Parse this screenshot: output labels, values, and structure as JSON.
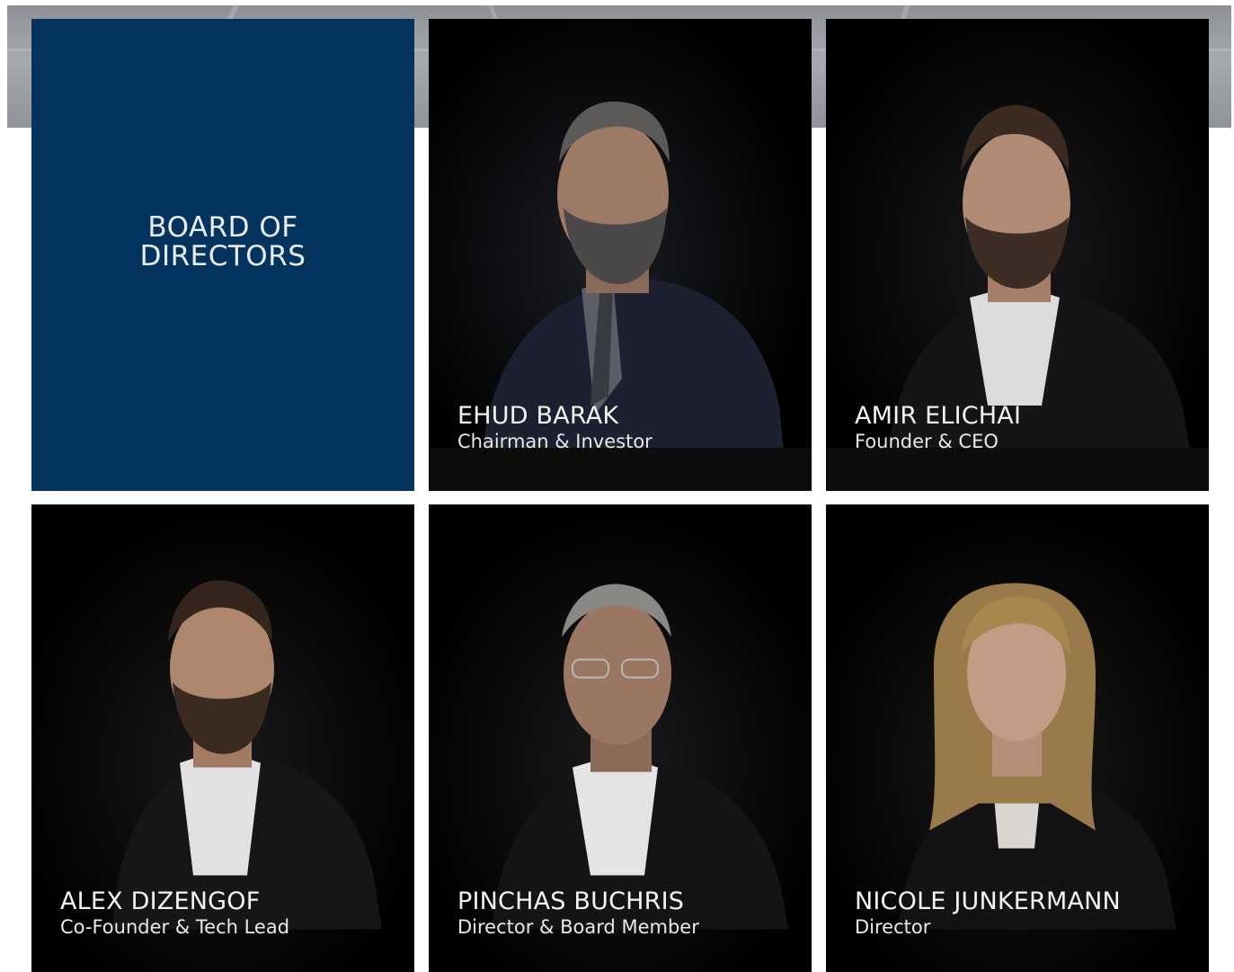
{
  "intro": {
    "title": "BOARD OF DIRECTORS"
  },
  "members": [
    {
      "name": "EHUD BARAK",
      "role": "Chairman & Investor"
    },
    {
      "name": "AMIR ELICHAI",
      "role": "Founder & CEO"
    },
    {
      "name": "ALEX DIZENGOF",
      "role": "Co-Founder & Tech Lead"
    },
    {
      "name": "PINCHAS BUCHRIS",
      "role": "Director & Board Member"
    },
    {
      "name": "NICOLE JUNKERMANN",
      "role": "Director"
    }
  ],
  "colors": {
    "intro_bg": "#04345d",
    "card_bg": "#000000",
    "banner": "#9a9ea3"
  },
  "icons": {
    "portraits": [
      "man-grey-beard-portrait",
      "man-beard-portrait",
      "man-beard-portrait",
      "man-glasses-portrait",
      "woman-blonde-portrait"
    ]
  }
}
